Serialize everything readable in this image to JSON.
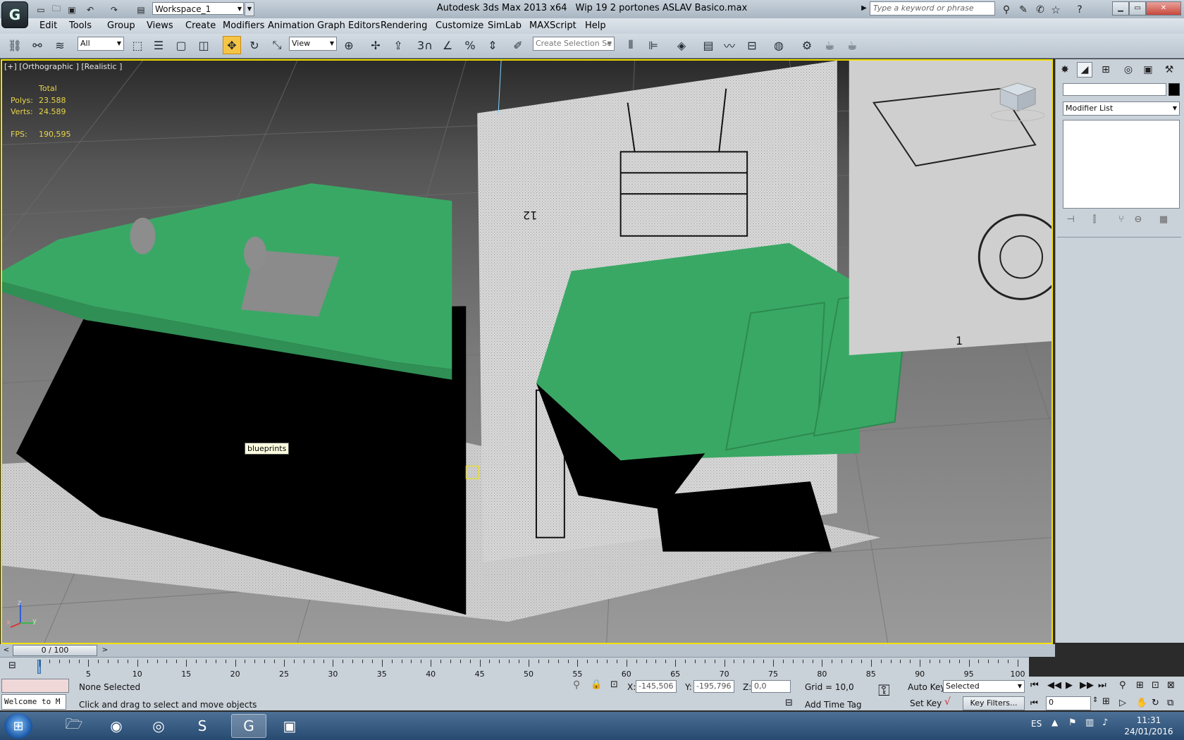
{
  "titlebar": {
    "workspace": "Workspace_1",
    "app_name": "Autodesk 3ds Max  2013 x64",
    "file_name": "Wip 19 2 portones ASLAV Basico.max",
    "search_placeholder": "Type a keyword or phrase"
  },
  "menu": [
    "Edit",
    "Tools",
    "Group",
    "Views",
    "Create",
    "Modifiers",
    "Animation",
    "Graph Editors",
    "Rendering",
    "Customize",
    "SimLab",
    "MAXScript",
    "Help"
  ],
  "toolbar": {
    "selection_filter": "All",
    "ref_coord": "View",
    "snaps_label": "3",
    "named_selection_placeholder": "Create Selection Se"
  },
  "viewport": {
    "label": "[+] [Orthographic ] [Realistic ]",
    "stats_header": "Total",
    "polys_label": "Polys:",
    "polys_value": "23.588",
    "verts_label": "Verts:",
    "verts_value": "24.589",
    "fps_label": "FPS:",
    "fps_value": "190,595",
    "tooltip": "blueprints",
    "blueprint_labels": [
      "12",
      "1"
    ],
    "axis": {
      "z": "z",
      "x": "x",
      "y": "y"
    }
  },
  "command_panel": {
    "modifier_list": "Modifier List"
  },
  "time_slider": {
    "position": "0 / 100",
    "ticks": [
      "5",
      "10",
      "15",
      "20",
      "25",
      "30",
      "35",
      "40",
      "45",
      "50",
      "55",
      "60",
      "65",
      "70",
      "75",
      "80",
      "85",
      "90",
      "95",
      "100"
    ]
  },
  "status": {
    "script_listener": "Welcome to M",
    "selection": "None Selected",
    "prompt": "Click and drag to select and move objects",
    "x_label": "X:",
    "x_value": "-145,506",
    "y_label": "Y:",
    "y_value": "-195,796",
    "z_label": "Z:",
    "z_value": "0,0",
    "grid": "Grid = 10,0",
    "add_time_tag": "Add Time Tag",
    "auto_key": "Auto Key",
    "set_key": "Set Key",
    "selected": "Selected",
    "key_filters": "Key Filters...",
    "frame": "0"
  },
  "taskbar": {
    "lang": "ES",
    "time": "11:31",
    "date": "24/01/2016"
  },
  "colors": {
    "viewport_border": "#f2e100",
    "model_green": "#3aa865",
    "active_tool": "#f6c445"
  }
}
